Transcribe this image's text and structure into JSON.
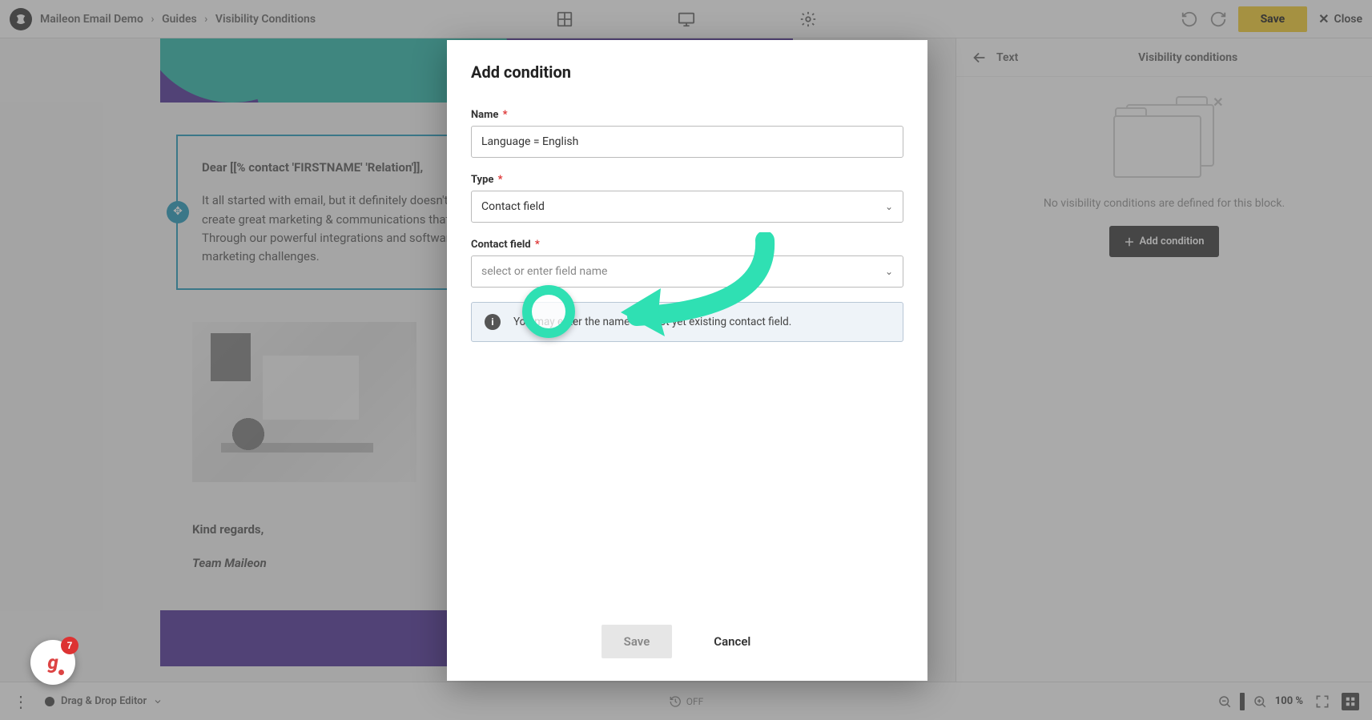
{
  "breadcrumb": {
    "parts": [
      "Maileon Email Demo",
      "Guides",
      "Visibility Conditions"
    ],
    "sep": "›"
  },
  "topbar": {
    "save": "Save",
    "close": "Close"
  },
  "email": {
    "greeting": "Dear [[% contact 'FIRSTNAME' 'Relation']],",
    "body_partial": "It all started with email, but it definitely doesn't end there. At Maileon, we provide everything you need to create great marketing & communications that resonate with your audience and exceed expectations. Through our powerful integrations and software solutions, you get all the tools you need to tackle your marketing challenges.",
    "regards": "Kind regards,",
    "team": "Team Maileon"
  },
  "sidepanel": {
    "back_label": "Text",
    "title": "Visibility conditions",
    "empty_msg": "No visibility conditions are defined for this block.",
    "add_button": "Add condition"
  },
  "bottombar": {
    "mode": "Drag & Drop Editor",
    "center_label": "OFF",
    "zoom": "100 %"
  },
  "modal": {
    "title": "Add condition",
    "labels": {
      "name": "Name",
      "type": "Type",
      "contact_field": "Contact field"
    },
    "required_mark": "*",
    "name_value": "Language = English",
    "type_value": "Contact field",
    "contact_field_placeholder": "select or enter field name",
    "info_text": "You may enter the name of a not yet existing contact field.",
    "save": "Save",
    "cancel": "Cancel"
  },
  "notif": {
    "letter": "g",
    "count": "7"
  }
}
